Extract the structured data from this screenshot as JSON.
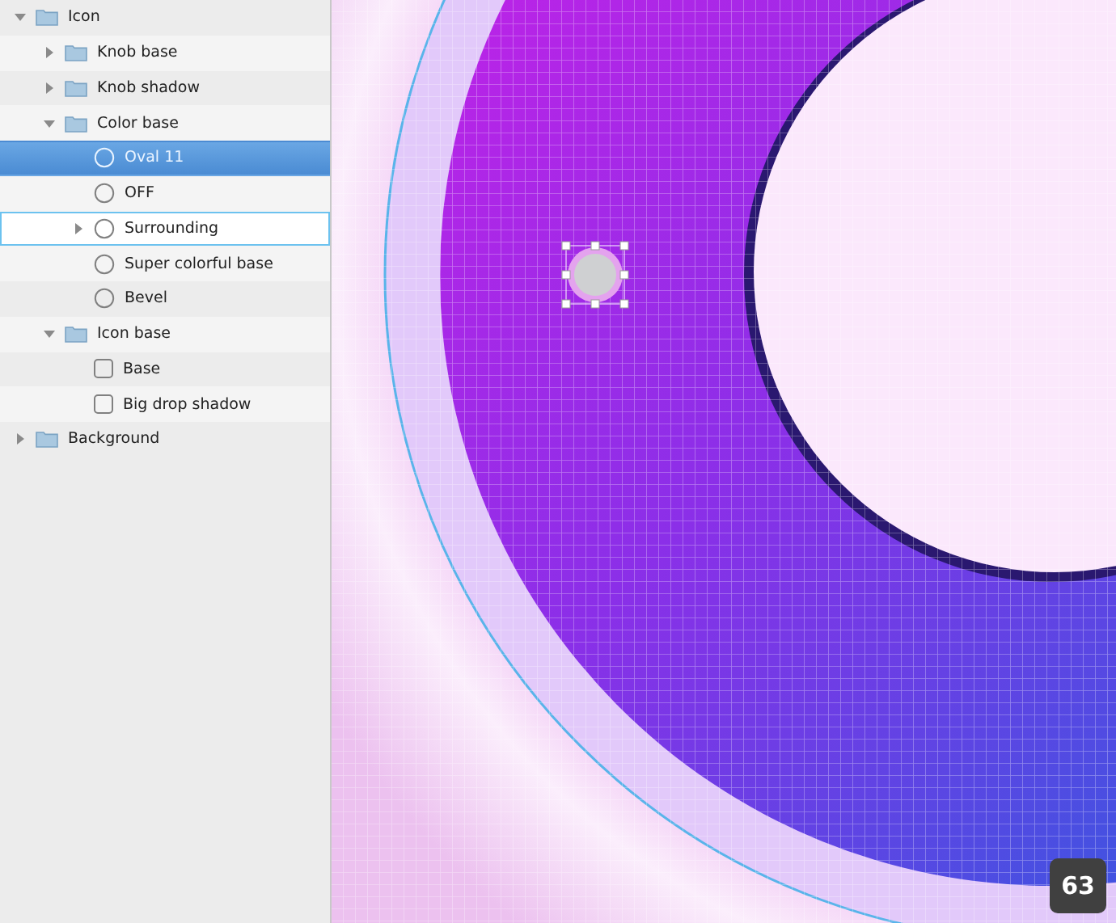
{
  "layers": [
    {
      "name": "Icon",
      "kind": "group",
      "expanded": true,
      "selected": false,
      "hovered": false,
      "children": [
        {
          "name": "Knob base",
          "kind": "group",
          "expanded": false,
          "selected": false,
          "hovered": false
        },
        {
          "name": "Knob shadow",
          "kind": "group",
          "expanded": false,
          "selected": false,
          "hovered": false
        },
        {
          "name": "Color base",
          "kind": "group",
          "expanded": true,
          "selected": false,
          "hovered": false,
          "children": [
            {
              "name": "Oval 11",
              "kind": "oval",
              "selected": true,
              "hovered": false
            },
            {
              "name": "OFF",
              "kind": "oval",
              "selected": false,
              "hovered": false
            },
            {
              "name": "Surrounding",
              "kind": "oval",
              "expanded": false,
              "selected": false,
              "hovered": true
            },
            {
              "name": "Super colorful base",
              "kind": "oval",
              "selected": false,
              "hovered": false
            },
            {
              "name": "Bevel",
              "kind": "oval",
              "selected": false,
              "hovered": false
            }
          ]
        },
        {
          "name": "Icon base",
          "kind": "group",
          "expanded": true,
          "selected": false,
          "hovered": false,
          "children": [
            {
              "name": "Base",
              "kind": "rectangle",
              "selected": false,
              "hovered": false
            },
            {
              "name": "Big drop shadow",
              "kind": "rectangle",
              "selected": false,
              "hovered": false
            }
          ]
        }
      ]
    },
    {
      "name": "Background",
      "kind": "group",
      "expanded": false,
      "selected": false,
      "hovered": false
    }
  ],
  "zoom_badge": "63"
}
